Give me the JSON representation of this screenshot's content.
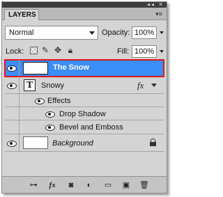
{
  "panel": {
    "tab_label": "LAYERS",
    "top_controls": "◂◂ ✕",
    "menu_glyph": "▾≡"
  },
  "blend": {
    "mode": "Normal",
    "opacity_label": "Opacity:",
    "opacity_value": "100%"
  },
  "lock": {
    "label": "Lock:",
    "fill_label": "Fill:",
    "fill_value": "100%",
    "icons": [
      "transparency-lock-icon",
      "brush-lock-icon",
      "move-lock-icon",
      "padlock-icon"
    ]
  },
  "layers": [
    {
      "name": "The Snow",
      "selected": true,
      "visible": true,
      "kind": "pixel"
    },
    {
      "name": "Snowy",
      "visible": true,
      "kind": "text",
      "has_fx": true,
      "effects_label": "Effects",
      "effects": [
        "Drop Shadow",
        "Bevel and Emboss"
      ]
    },
    {
      "name": "Background",
      "visible": true,
      "kind": "background",
      "locked": true
    }
  ],
  "toolbar": {
    "icons": [
      "link-layers-icon",
      "fx-icon",
      "mask-icon",
      "adjustment-icon",
      "group-folder-icon",
      "new-layer-icon",
      "trash-icon"
    ],
    "glyphs": [
      "⊶",
      "fx",
      "◙",
      "◐",
      "▭",
      "▣",
      "🗑"
    ]
  },
  "colors": {
    "selection": "#3b8df7",
    "highlight_outline": "#e0161c",
    "panel_bg": "#d4d4d4"
  }
}
